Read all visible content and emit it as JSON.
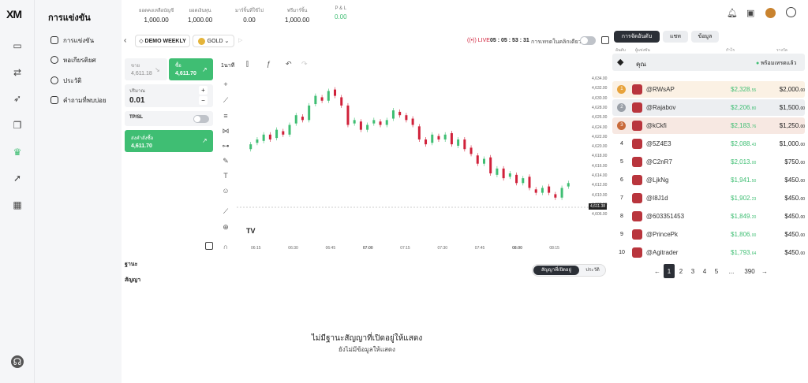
{
  "logo": "XM",
  "nav": {
    "title": "การแข่งขัน",
    "items": [
      "การแข่งขัน",
      "หอเกียรติยศ",
      "ประวัติ",
      "คำถามที่พบบ่อย"
    ]
  },
  "stats": [
    {
      "label": "ยอดคงเหลือบัญชี",
      "value": "1,000.00"
    },
    {
      "label": "ยอดเงินทุน",
      "value": "1,000.00"
    },
    {
      "label": "มาร์จิ้นที่ใช้ไป",
      "value": "0.00"
    },
    {
      "label": "ฟรีมาร์จิ้น",
      "value": "1,000.00"
    },
    {
      "label": "P & L",
      "value": "0.00"
    }
  ],
  "toolbar": {
    "account": "DEMO WEEKLY",
    "symbol": "GOLD",
    "live": "LIVE",
    "timer": "05 : 05 : 53 : 31",
    "oneclick": "การเทรดในคลิกเดียว"
  },
  "order": {
    "sell_label": "ขาย",
    "sell_price": "4,611.18",
    "buy_label": "ซื้อ",
    "buy_price": "4,611.70",
    "qty_label": "ปริมาณ",
    "qty": "0.01",
    "tpsl": "TP/SL",
    "place_label": "ส่งคำสั่งซื้อ",
    "place_price": "4,611.70"
  },
  "chart": {
    "interval": "1นาที",
    "last_price": "4,611.38",
    "bid_price": "4,612.00",
    "yticks": [
      "4,634.00",
      "4,632.00",
      "4,630.00",
      "4,628.00",
      "4,626.00",
      "4,624.00",
      "4,622.00",
      "4,620.00",
      "4,618.00",
      "4,616.00",
      "4,614.00",
      "4,612.00",
      "4,610.00",
      "4,608.00",
      "4,606.00"
    ],
    "xticks": [
      "06:15",
      "06:30",
      "06:45",
      "07:00",
      "07:15",
      "07:30",
      "07:45",
      "08:00",
      "08:15"
    ]
  },
  "positions": {
    "title": "ฐานะ",
    "contracts": "สัญญา",
    "tab_open": "สัญญาที่เปิดอยู่",
    "tab_history": "ประวัติ",
    "empty_title": "ไม่มีฐานะสัญญาที่เปิดอยู่ให้แสดง",
    "empty_sub": "ยังไม่มีข้อมูลให้แสดง"
  },
  "right": {
    "tabs": [
      "การจัดอันดับ",
      "แชท",
      "ข้อมูล"
    ],
    "cols": [
      "อันดับ",
      "ผู้แข่งขัน",
      "กำไร",
      "รางวัล"
    ],
    "you": "คุณ",
    "ready": "พร้อมเทรดแล้ว",
    "rows": [
      {
        "rank": "1",
        "name": "@RWsAP",
        "profit": "$2,328.",
        "profit_dec": "55",
        "prize": "$2,000.",
        "prize_dec": "00"
      },
      {
        "rank": "2",
        "name": "@Rajabov",
        "profit": "$2,206.",
        "profit_dec": "80",
        "prize": "$1,500.",
        "prize_dec": "00"
      },
      {
        "rank": "3",
        "name": "@kCkfi",
        "profit": "$2,183.",
        "profit_dec": "76",
        "prize": "$1,250.",
        "prize_dec": "00"
      },
      {
        "rank": "4",
        "name": "@5Z4E3",
        "profit": "$2,088.",
        "profit_dec": "43",
        "prize": "$1,000.",
        "prize_dec": "00"
      },
      {
        "rank": "5",
        "name": "@C2nR7",
        "profit": "$2,013.",
        "profit_dec": "00",
        "prize": "$750.",
        "prize_dec": "00"
      },
      {
        "rank": "6",
        "name": "@LjkNg",
        "profit": "$1,941.",
        "profit_dec": "50",
        "prize": "$450.",
        "prize_dec": "00"
      },
      {
        "rank": "7",
        "name": "@I8J1d",
        "profit": "$1,902.",
        "profit_dec": "23",
        "prize": "$450.",
        "prize_dec": "00"
      },
      {
        "rank": "8",
        "name": "@603351453",
        "profit": "$1,849.",
        "profit_dec": "20",
        "prize": "$450.",
        "prize_dec": "00"
      },
      {
        "rank": "9",
        "name": "@PrincePk",
        "profit": "$1,806.",
        "profit_dec": "00",
        "prize": "$450.",
        "prize_dec": "00"
      },
      {
        "rank": "10",
        "name": "@Agitrader",
        "profit": "$1,793.",
        "profit_dec": "64",
        "prize": "$450.",
        "prize_dec": "00"
      }
    ],
    "pages": [
      "1",
      "2",
      "3",
      "4",
      "5",
      "...",
      "390"
    ]
  },
  "colors": {
    "green": "#3fbe73",
    "red": "#d0213a",
    "dark": "#2b2f36"
  }
}
